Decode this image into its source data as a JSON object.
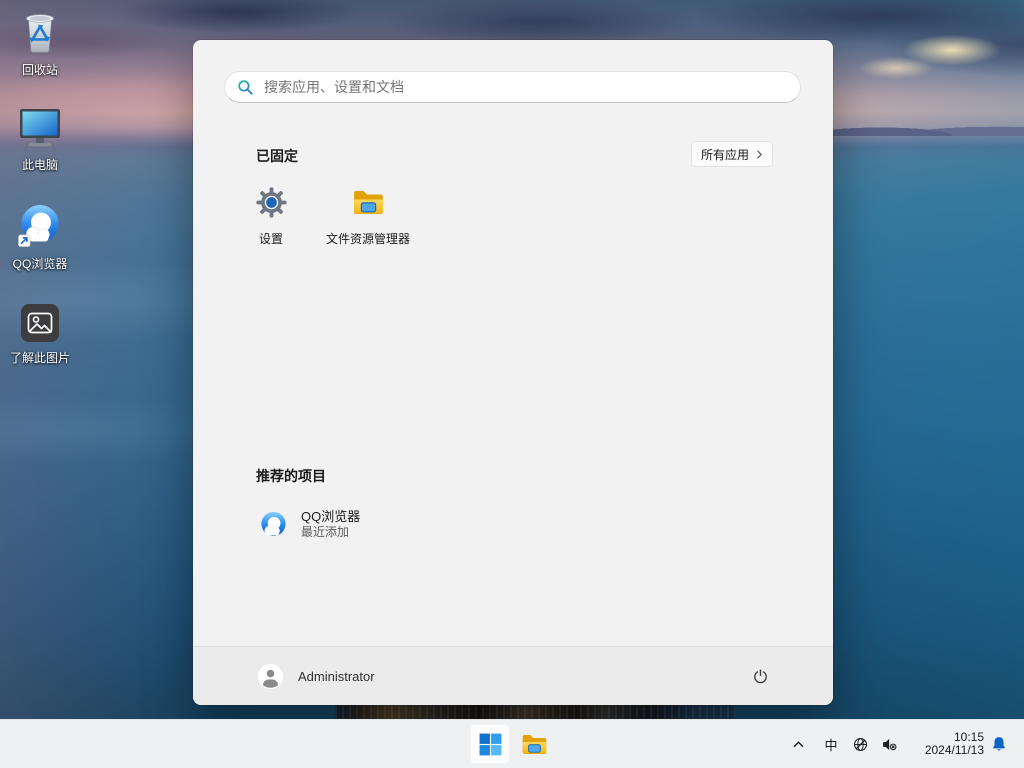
{
  "desktop": {
    "icons": [
      {
        "label": "回收站"
      },
      {
        "label": "此电脑"
      },
      {
        "label": "QQ浏览器"
      },
      {
        "label": "了解此图片"
      }
    ]
  },
  "start_menu": {
    "search_placeholder": "搜索应用、设置和文档",
    "pinned_title": "已固定",
    "all_apps_label": "所有应用",
    "pinned_apps": [
      {
        "label": "设置"
      },
      {
        "label": "文件资源管理器"
      }
    ],
    "recommended_title": "推荐的项目",
    "recommended": [
      {
        "label": "QQ浏览器",
        "sublabel": "最近添加"
      }
    ],
    "user_name": "Administrator"
  },
  "taskbar": {
    "ime_label": "中",
    "clock": {
      "time": "10:15",
      "date": "2024/11/13"
    }
  },
  "colors": {
    "accent_blue": "#0d64c8",
    "panel_bg": "#f2f2f2",
    "taskbar_bg": "#eef0f1"
  }
}
